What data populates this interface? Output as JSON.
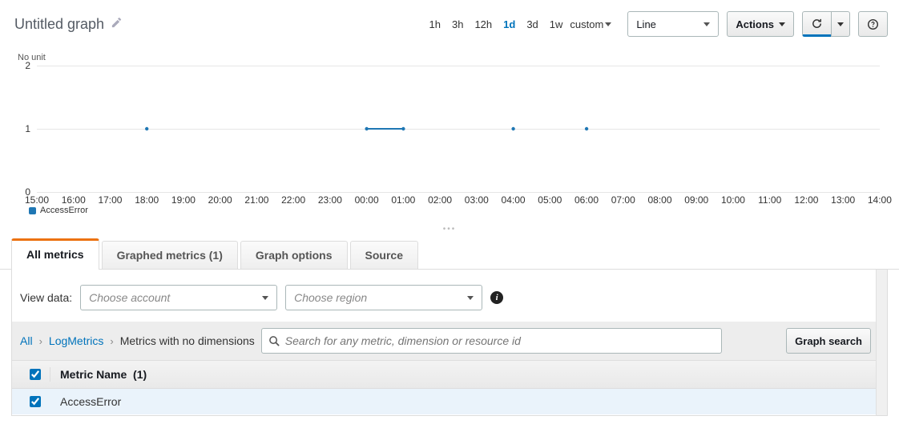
{
  "header": {
    "title": "Untitled graph",
    "time_ranges": [
      "1h",
      "3h",
      "12h",
      "1d",
      "3d",
      "1w"
    ],
    "time_active": "1d",
    "custom_label": "custom",
    "chart_type": "Line",
    "actions_label": "Actions"
  },
  "chart": {
    "y_unit": "No unit",
    "legend": "AccessError",
    "accent": "#1f77b4"
  },
  "chart_data": {
    "type": "line",
    "title": "",
    "xlabel": "",
    "ylabel": "No unit",
    "ylim": [
      0,
      2
    ],
    "y_ticks": [
      0,
      1,
      2
    ],
    "x_ticks": [
      "15:00",
      "16:00",
      "17:00",
      "18:00",
      "19:00",
      "20:00",
      "21:00",
      "22:00",
      "23:00",
      "00:00",
      "01:00",
      "02:00",
      "03:00",
      "04:00",
      "05:00",
      "06:00",
      "07:00",
      "08:00",
      "09:00",
      "10:00",
      "11:00",
      "12:00",
      "13:00",
      "14:00"
    ],
    "series": [
      {
        "name": "AccessError",
        "color": "#1f77b4",
        "points": [
          {
            "x_index": 3,
            "y": 1
          },
          {
            "x_index": 9,
            "y": 1
          },
          {
            "x_index": 10,
            "y": 1
          },
          {
            "x_index": 13,
            "y": 1
          },
          {
            "x_index": 15,
            "y": 1
          }
        ],
        "segments": [
          {
            "from_x_index": 9,
            "to_x_index": 10,
            "y": 1
          }
        ]
      }
    ]
  },
  "tabs": {
    "items": [
      "All metrics",
      "Graphed metrics (1)",
      "Graph options",
      "Source"
    ],
    "active": 0
  },
  "view_data": {
    "label": "View data:",
    "account_placeholder": "Choose account",
    "region_placeholder": "Choose region"
  },
  "breadcrumb": {
    "all": "All",
    "log_metrics": "LogMetrics",
    "leaf": "Metrics with no dimensions",
    "search_placeholder": "Search for any metric, dimension or resource id",
    "graph_search": "Graph search"
  },
  "table": {
    "header_label": "Metric Name",
    "header_count": "(1)",
    "rows": [
      {
        "name": "AccessError",
        "checked": true
      }
    ],
    "select_all": true
  }
}
